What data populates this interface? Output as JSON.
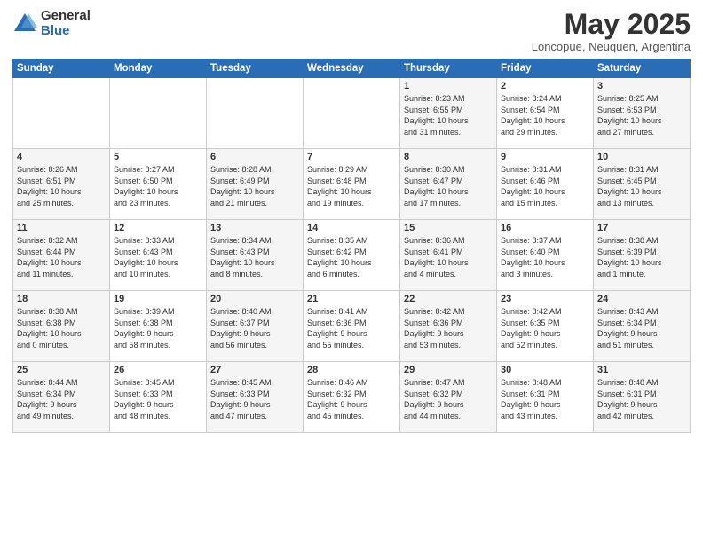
{
  "logo": {
    "general": "General",
    "blue": "Blue"
  },
  "title": "May 2025",
  "subtitle": "Loncopue, Neuquen, Argentina",
  "days_of_week": [
    "Sunday",
    "Monday",
    "Tuesday",
    "Wednesday",
    "Thursday",
    "Friday",
    "Saturday"
  ],
  "weeks": [
    [
      {
        "day": "",
        "info": ""
      },
      {
        "day": "",
        "info": ""
      },
      {
        "day": "",
        "info": ""
      },
      {
        "day": "",
        "info": ""
      },
      {
        "day": "1",
        "info": "Sunrise: 8:23 AM\nSunset: 6:55 PM\nDaylight: 10 hours\nand 31 minutes."
      },
      {
        "day": "2",
        "info": "Sunrise: 8:24 AM\nSunset: 6:54 PM\nDaylight: 10 hours\nand 29 minutes."
      },
      {
        "day": "3",
        "info": "Sunrise: 8:25 AM\nSunset: 6:53 PM\nDaylight: 10 hours\nand 27 minutes."
      }
    ],
    [
      {
        "day": "4",
        "info": "Sunrise: 8:26 AM\nSunset: 6:51 PM\nDaylight: 10 hours\nand 25 minutes."
      },
      {
        "day": "5",
        "info": "Sunrise: 8:27 AM\nSunset: 6:50 PM\nDaylight: 10 hours\nand 23 minutes."
      },
      {
        "day": "6",
        "info": "Sunrise: 8:28 AM\nSunset: 6:49 PM\nDaylight: 10 hours\nand 21 minutes."
      },
      {
        "day": "7",
        "info": "Sunrise: 8:29 AM\nSunset: 6:48 PM\nDaylight: 10 hours\nand 19 minutes."
      },
      {
        "day": "8",
        "info": "Sunrise: 8:30 AM\nSunset: 6:47 PM\nDaylight: 10 hours\nand 17 minutes."
      },
      {
        "day": "9",
        "info": "Sunrise: 8:31 AM\nSunset: 6:46 PM\nDaylight: 10 hours\nand 15 minutes."
      },
      {
        "day": "10",
        "info": "Sunrise: 8:31 AM\nSunset: 6:45 PM\nDaylight: 10 hours\nand 13 minutes."
      }
    ],
    [
      {
        "day": "11",
        "info": "Sunrise: 8:32 AM\nSunset: 6:44 PM\nDaylight: 10 hours\nand 11 minutes."
      },
      {
        "day": "12",
        "info": "Sunrise: 8:33 AM\nSunset: 6:43 PM\nDaylight: 10 hours\nand 10 minutes."
      },
      {
        "day": "13",
        "info": "Sunrise: 8:34 AM\nSunset: 6:43 PM\nDaylight: 10 hours\nand 8 minutes."
      },
      {
        "day": "14",
        "info": "Sunrise: 8:35 AM\nSunset: 6:42 PM\nDaylight: 10 hours\nand 6 minutes."
      },
      {
        "day": "15",
        "info": "Sunrise: 8:36 AM\nSunset: 6:41 PM\nDaylight: 10 hours\nand 4 minutes."
      },
      {
        "day": "16",
        "info": "Sunrise: 8:37 AM\nSunset: 6:40 PM\nDaylight: 10 hours\nand 3 minutes."
      },
      {
        "day": "17",
        "info": "Sunrise: 8:38 AM\nSunset: 6:39 PM\nDaylight: 10 hours\nand 1 minute."
      }
    ],
    [
      {
        "day": "18",
        "info": "Sunrise: 8:38 AM\nSunset: 6:38 PM\nDaylight: 10 hours\nand 0 minutes."
      },
      {
        "day": "19",
        "info": "Sunrise: 8:39 AM\nSunset: 6:38 PM\nDaylight: 9 hours\nand 58 minutes."
      },
      {
        "day": "20",
        "info": "Sunrise: 8:40 AM\nSunset: 6:37 PM\nDaylight: 9 hours\nand 56 minutes."
      },
      {
        "day": "21",
        "info": "Sunrise: 8:41 AM\nSunset: 6:36 PM\nDaylight: 9 hours\nand 55 minutes."
      },
      {
        "day": "22",
        "info": "Sunrise: 8:42 AM\nSunset: 6:36 PM\nDaylight: 9 hours\nand 53 minutes."
      },
      {
        "day": "23",
        "info": "Sunrise: 8:42 AM\nSunset: 6:35 PM\nDaylight: 9 hours\nand 52 minutes."
      },
      {
        "day": "24",
        "info": "Sunrise: 8:43 AM\nSunset: 6:34 PM\nDaylight: 9 hours\nand 51 minutes."
      }
    ],
    [
      {
        "day": "25",
        "info": "Sunrise: 8:44 AM\nSunset: 6:34 PM\nDaylight: 9 hours\nand 49 minutes."
      },
      {
        "day": "26",
        "info": "Sunrise: 8:45 AM\nSunset: 6:33 PM\nDaylight: 9 hours\nand 48 minutes."
      },
      {
        "day": "27",
        "info": "Sunrise: 8:45 AM\nSunset: 6:33 PM\nDaylight: 9 hours\nand 47 minutes."
      },
      {
        "day": "28",
        "info": "Sunrise: 8:46 AM\nSunset: 6:32 PM\nDaylight: 9 hours\nand 45 minutes."
      },
      {
        "day": "29",
        "info": "Sunrise: 8:47 AM\nSunset: 6:32 PM\nDaylight: 9 hours\nand 44 minutes."
      },
      {
        "day": "30",
        "info": "Sunrise: 8:48 AM\nSunset: 6:31 PM\nDaylight: 9 hours\nand 43 minutes."
      },
      {
        "day": "31",
        "info": "Sunrise: 8:48 AM\nSunset: 6:31 PM\nDaylight: 9 hours\nand 42 minutes."
      }
    ]
  ]
}
